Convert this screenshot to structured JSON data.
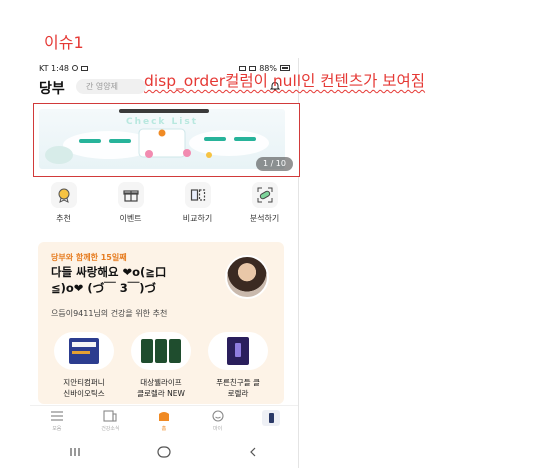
{
  "issue_title": "이슈1",
  "overlay_note": "disp_order컬럼이 null인 컨텐츠가 보여짐",
  "status_bar": {
    "time": "KT 1:48",
    "battery": "88%"
  },
  "app": {
    "logo": "당부",
    "search_placeholder": "간 영양제"
  },
  "banner": {
    "title": "Check List",
    "page_indicator": "1 / 10"
  },
  "quick_menu": [
    {
      "label": "추천",
      "icon": "medal-icon"
    },
    {
      "label": "이벤트",
      "icon": "gift-icon"
    },
    {
      "label": "비교하기",
      "icon": "compare-icon"
    },
    {
      "label": "분석하기",
      "icon": "pill-analysis-icon"
    }
  ],
  "recommend_card": {
    "kicker": "당부와 함께한 15일째",
    "heading": "다들 싸랑해요 ❤o(≧口\n≦)o❤ (づ￣ 3￣)づ",
    "subtitle": "으듬이9411님의 건강을 위한 추천",
    "products": [
      {
        "label": "지안티컴퍼니\n신바이오틱스"
      },
      {
        "label": "대상웰라이프\n클로렐라 NEW"
      },
      {
        "label": "푸른친구들 클\n로렐라"
      }
    ]
  },
  "tab_bar": [
    {
      "label": "모음",
      "icon": "menu-icon"
    },
    {
      "label": "건강소식",
      "icon": "news-icon"
    },
    {
      "label": "홈",
      "icon": "home-icon",
      "active": true
    },
    {
      "label": "마이",
      "icon": "profile-icon"
    },
    {
      "label": "",
      "icon": "phone-icon"
    }
  ],
  "nav_bar": [
    {
      "icon": "recent-apps-icon"
    },
    {
      "icon": "home-circle-icon"
    },
    {
      "icon": "back-icon"
    }
  ],
  "colors": {
    "annotation": "#e53935",
    "accent": "#f08a24",
    "card_bg": "#fdf3e7"
  }
}
